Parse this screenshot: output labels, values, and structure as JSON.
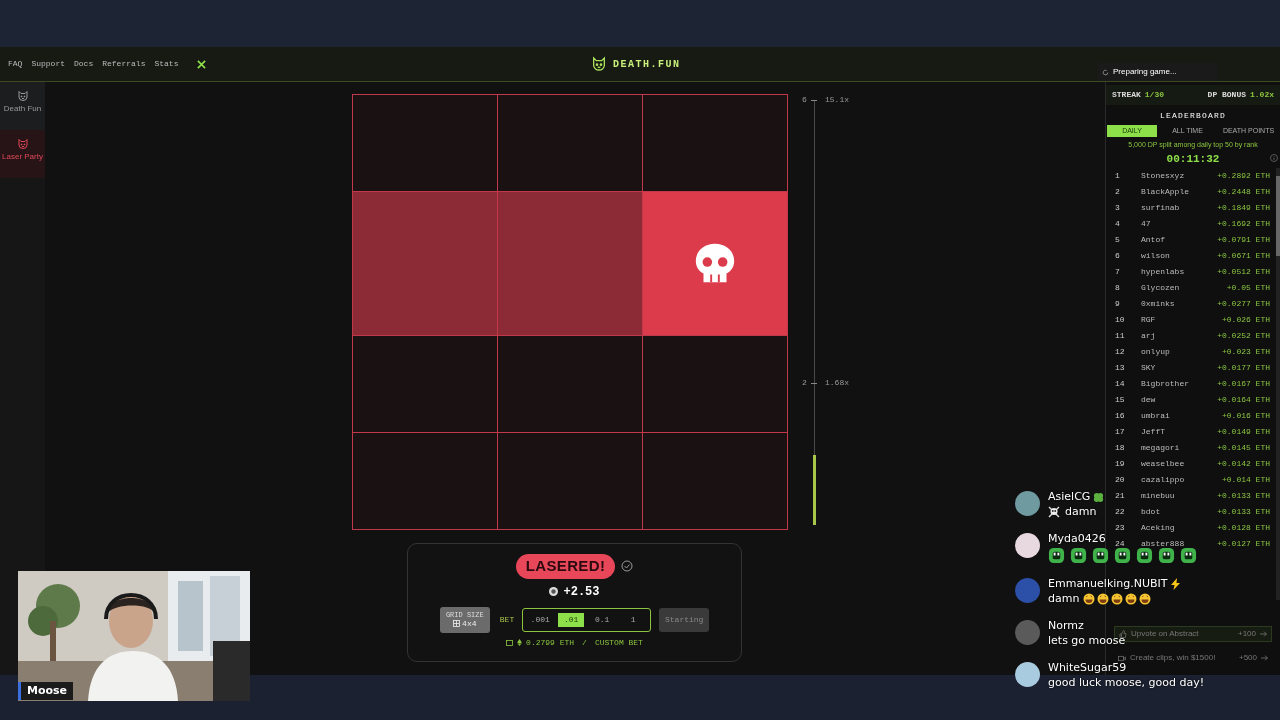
{
  "header": {
    "nav": [
      "FAQ",
      "Support",
      "Docs",
      "Referrals",
      "Stats"
    ],
    "logo_text": "DEATH.FUN"
  },
  "sidebar": {
    "items": [
      {
        "label": "Death Fun",
        "selected": false
      },
      {
        "label": "Laser Party",
        "selected": true
      }
    ]
  },
  "game": {
    "grid": [
      [
        {
          "kind": "empty"
        },
        {
          "kind": "empty"
        },
        {
          "kind": "empty"
        }
      ],
      [
        {
          "kind": "lasered"
        },
        {
          "kind": "lasered"
        },
        {
          "kind": "skull"
        }
      ],
      [
        {
          "kind": "empty"
        },
        {
          "kind": "empty"
        },
        {
          "kind": "empty"
        }
      ],
      [
        {
          "kind": "empty"
        },
        {
          "kind": "empty"
        },
        {
          "kind": "empty"
        }
      ]
    ],
    "scale": {
      "labels": [
        {
          "count": "6",
          "multiplier": "15.1x"
        },
        {
          "count": "2",
          "multiplier": "1.68x"
        }
      ],
      "level": 0.165
    }
  },
  "result": {
    "badge": "LASERED!",
    "payout": "+2.53",
    "grid_size": {
      "label": "GRID SIZE",
      "value": "4x4"
    },
    "bet": {
      "label": "BET",
      "options": [
        {
          "label": ".001",
          "selected": false
        },
        {
          "label": ".01",
          "selected": true
        },
        {
          "label": "0.1",
          "selected": false
        },
        {
          "label": "1",
          "selected": false
        }
      ]
    },
    "start_button": {
      "label": "Starting",
      "disabled": true
    },
    "balance": "0.2799 ETH",
    "separator": "/",
    "custom_bet": "CUSTOM BET"
  },
  "toast": {
    "text": "Preparing game..."
  },
  "leaderboard": {
    "streak_label": "STREAK",
    "streak": "1/30",
    "bonus_label": "DP BONUS",
    "bonus": "1.02x",
    "title": "LEADERBOARD",
    "tabs": [
      {
        "label": "DAILY",
        "selected": true
      },
      {
        "label": "ALL TIME",
        "selected": false
      },
      {
        "label": "DEATH POINTS",
        "selected": false
      }
    ],
    "note": "5,000 DP split among daily top 50 by rank",
    "timer": "00:11:32",
    "rows": [
      {
        "rank": "1",
        "name": "Stonesxyz",
        "amount": "+0.2892 ETH"
      },
      {
        "rank": "2",
        "name": "BlackApple",
        "amount": "+0.2448 ETH"
      },
      {
        "rank": "3",
        "name": "surfinab",
        "amount": "+0.1849 ETH"
      },
      {
        "rank": "4",
        "name": "47",
        "amount": "+0.1692 ETH"
      },
      {
        "rank": "5",
        "name": "Antof",
        "amount": "+0.0791 ETH"
      },
      {
        "rank": "6",
        "name": "wilson",
        "amount": "+0.0671 ETH"
      },
      {
        "rank": "7",
        "name": "hypenlabs",
        "amount": "+0.0512 ETH"
      },
      {
        "rank": "8",
        "name": "Glycozen",
        "amount": "+0.05 ETH"
      },
      {
        "rank": "9",
        "name": "0xminks",
        "amount": "+0.0277 ETH"
      },
      {
        "rank": "10",
        "name": "RGF",
        "amount": "+0.026 ETH"
      },
      {
        "rank": "11",
        "name": "arj",
        "amount": "+0.0252 ETH"
      },
      {
        "rank": "12",
        "name": "onlyup",
        "amount": "+0.023 ETH"
      },
      {
        "rank": "13",
        "name": "SKY",
        "amount": "+0.0177 ETH"
      },
      {
        "rank": "14",
        "name": "Bigbrother",
        "amount": "+0.0167 ETH"
      },
      {
        "rank": "15",
        "name": "dew",
        "amount": "+0.0164 ETH"
      },
      {
        "rank": "16",
        "name": "umbrai",
        "amount": "+0.016 ETH"
      },
      {
        "rank": "17",
        "name": "JeffT",
        "amount": "+0.0149 ETH"
      },
      {
        "rank": "18",
        "name": "megagori",
        "amount": "+0.0145 ETH"
      },
      {
        "rank": "19",
        "name": "weaselbee",
        "amount": "+0.0142 ETH"
      },
      {
        "rank": "20",
        "name": "cazalippo",
        "amount": "+0.014 ETH"
      },
      {
        "rank": "21",
        "name": "minebuu",
        "amount": "+0.0133 ETH"
      },
      {
        "rank": "22",
        "name": "bdot",
        "amount": "+0.0133 ETH"
      },
      {
        "rank": "23",
        "name": "Aceking",
        "amount": "+0.0128 ETH"
      },
      {
        "rank": "24",
        "name": "abster888",
        "amount": "+0.0127 ETH"
      }
    ],
    "tasks": [
      {
        "kind": "upvote",
        "label": "Upvote on Abstract",
        "points": "+100"
      },
      {
        "kind": "clips",
        "label": "Create clips, win $1500!",
        "points": "+500"
      }
    ]
  },
  "chat": {
    "messages": [
      {
        "author": "AsielCG",
        "badge": {
          "kind": "clover"
        },
        "kind": "skull",
        "text": "damn"
      },
      {
        "author": "Myda0426",
        "kind": "emotes"
      },
      {
        "author": "Emmanuelking.NUBIT",
        "badge": {
          "kind": "lightning"
        },
        "kind": "laughing",
        "text": "damn"
      },
      {
        "author": "Normz",
        "kind": "text",
        "text": "lets go moose"
      },
      {
        "author": "WhiteSugar59",
        "kind": "text",
        "text": "good luck moose, good day!"
      }
    ]
  },
  "webcam": {
    "name": "Moose"
  }
}
